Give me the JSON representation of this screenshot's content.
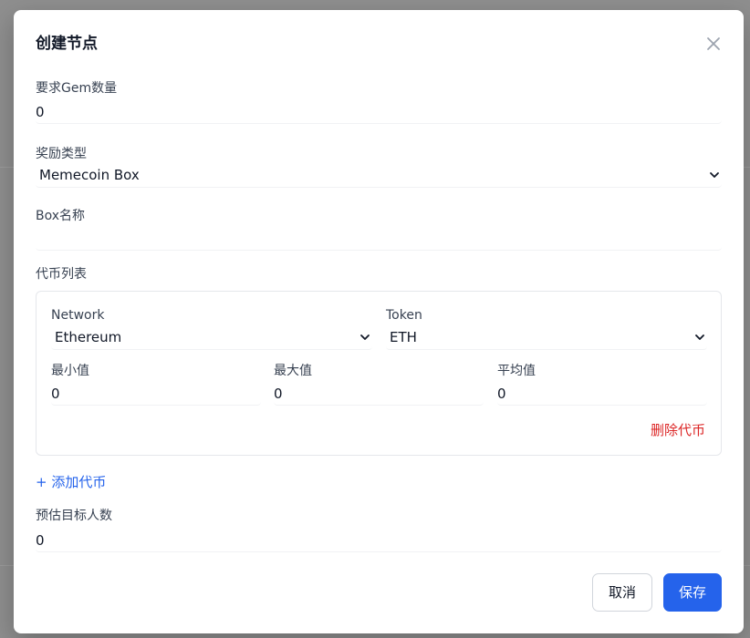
{
  "modal": {
    "title": "创建节点",
    "close_icon": "close-icon"
  },
  "fields": {
    "required_gem": {
      "label": "要求Gem数量",
      "value": "0"
    },
    "reward_type": {
      "label": "奖励类型",
      "value": "Memecoin Box"
    },
    "box_name": {
      "label": "Box名称",
      "value": ""
    },
    "token_list": {
      "label": "代币列表"
    },
    "estimated_target": {
      "label": "预估目标人数",
      "value": "0"
    }
  },
  "token_card": {
    "network": {
      "label": "Network",
      "value": "Ethereum"
    },
    "token": {
      "label": "Token",
      "value": "ETH"
    },
    "min": {
      "label": "最小值",
      "value": "0"
    },
    "max": {
      "label": "最大值",
      "value": "0"
    },
    "avg": {
      "label": "平均值",
      "value": "0"
    },
    "delete_label": "删除代币"
  },
  "add_token_label": "+ 添加代币",
  "footer": {
    "cancel_label": "取消",
    "save_label": "保存"
  },
  "colors": {
    "primary": "#2563eb",
    "danger": "#dc2626",
    "overlay": "#8f8f8f"
  }
}
